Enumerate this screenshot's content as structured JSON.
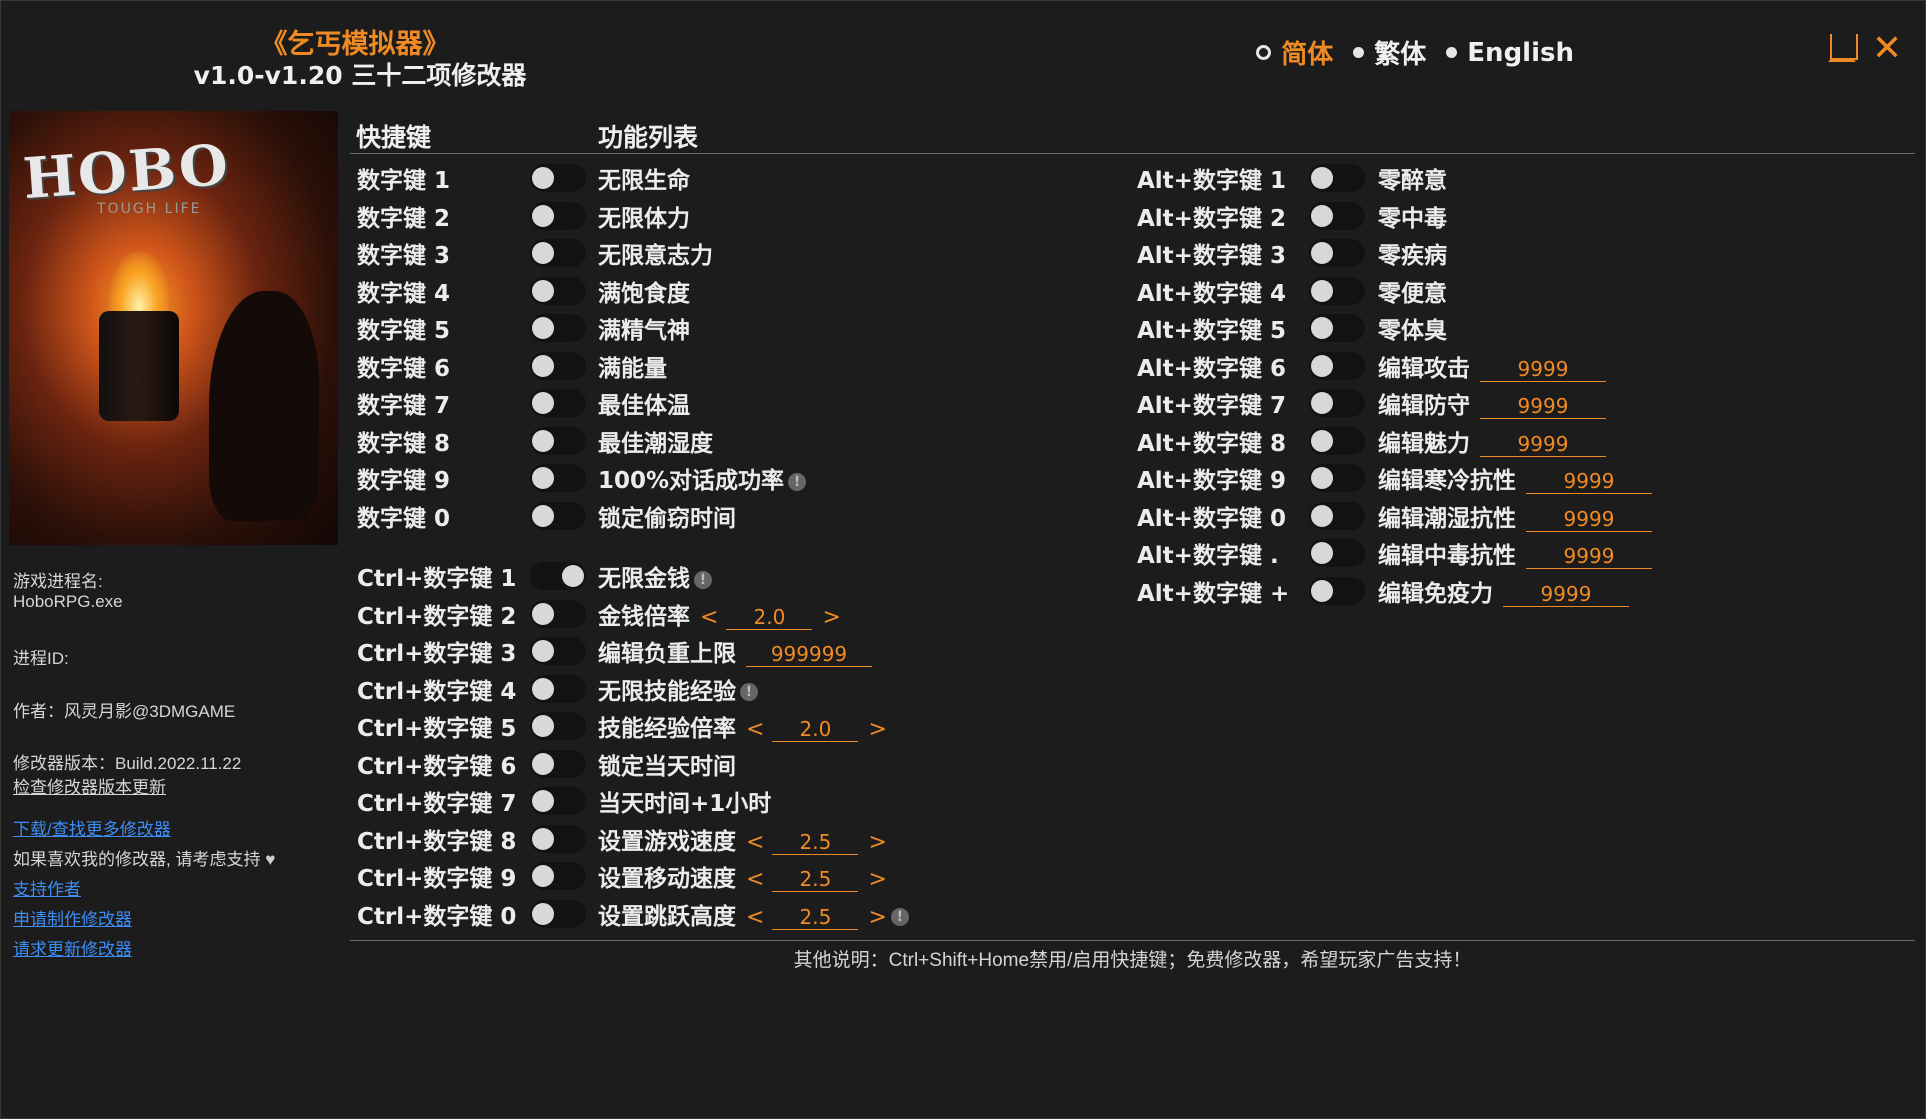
{
  "header": {
    "game_title": "《乞丐模拟器》",
    "version_title": "v1.0-v1.20 三十二项修改器"
  },
  "languages": [
    {
      "label": "简体",
      "active": true
    },
    {
      "label": "繁体",
      "active": false
    },
    {
      "label": "English",
      "active": false
    }
  ],
  "window_controls": {
    "minimize": "minimize-icon",
    "close": "close-icon",
    "close_glyph": "✕"
  },
  "cover": {
    "logo": "HOBO",
    "subtitle": "TOUGH LIFE"
  },
  "sidebar": {
    "process_label": "游戏进程名:",
    "process_name": "HoboRPG.exe",
    "pid_label": "进程ID:",
    "author": "作者：风灵月影@3DMGAME",
    "build": "修改器版本：Build.2022.11.22",
    "check_update": "检查修改器版本更新",
    "download_more": "下载/查找更多修改器",
    "support_text": "如果喜欢我的修改器, 请考虑支持",
    "support_author": "支持作者",
    "request_make": "申请制作修改器",
    "request_update": "请求更新修改器"
  },
  "columns": {
    "hotkey": "快捷键",
    "features": "功能列表"
  },
  "left_group1": [
    {
      "key": "数字键 1",
      "label": "无限生命",
      "on": false
    },
    {
      "key": "数字键 2",
      "label": "无限体力",
      "on": false
    },
    {
      "key": "数字键 3",
      "label": "无限意志力",
      "on": false
    },
    {
      "key": "数字键 4",
      "label": "满饱食度",
      "on": false
    },
    {
      "key": "数字键 5",
      "label": "满精气神",
      "on": false
    },
    {
      "key": "数字键 6",
      "label": "满能量",
      "on": false
    },
    {
      "key": "数字键 7",
      "label": "最佳体温",
      "on": false
    },
    {
      "key": "数字键 8",
      "label": "最佳潮湿度",
      "on": false
    },
    {
      "key": "数字键 9",
      "label": "100%对话成功率",
      "on": false,
      "info": true
    },
    {
      "key": "数字键 0",
      "label": "锁定偷窃时间",
      "on": false
    }
  ],
  "left_group2": [
    {
      "key": "Ctrl+数字键 1",
      "label": "无限金钱",
      "on": true,
      "info": true
    },
    {
      "key": "Ctrl+数字键 2",
      "label": "金钱倍率",
      "on": false,
      "stepper": "2.0"
    },
    {
      "key": "Ctrl+数字键 3",
      "label": "编辑负重上限",
      "on": false,
      "value": "999999"
    },
    {
      "key": "Ctrl+数字键 4",
      "label": "无限技能经验",
      "on": false,
      "info": true
    },
    {
      "key": "Ctrl+数字键 5",
      "label": "技能经验倍率",
      "on": false,
      "stepper": "2.0"
    },
    {
      "key": "Ctrl+数字键 6",
      "label": "锁定当天时间",
      "on": false
    },
    {
      "key": "Ctrl+数字键 7",
      "label": "当天时间+1小时",
      "on": false
    },
    {
      "key": "Ctrl+数字键 8",
      "label": "设置游戏速度",
      "on": false,
      "stepper": "2.5"
    },
    {
      "key": "Ctrl+数字键 9",
      "label": "设置移动速度",
      "on": false,
      "stepper": "2.5"
    },
    {
      "key": "Ctrl+数字键 0",
      "label": "设置跳跃高度",
      "on": false,
      "stepper": "2.5",
      "info": true
    }
  ],
  "right_group": [
    {
      "key": "Alt+数字键 1",
      "label": "零醉意",
      "on": false
    },
    {
      "key": "Alt+数字键 2",
      "label": "零中毒",
      "on": false
    },
    {
      "key": "Alt+数字键 3",
      "label": "零疾病",
      "on": false
    },
    {
      "key": "Alt+数字键 4",
      "label": "零便意",
      "on": false
    },
    {
      "key": "Alt+数字键 5",
      "label": "零体臭",
      "on": false
    },
    {
      "key": "Alt+数字键 6",
      "label": "编辑攻击",
      "on": false,
      "value": "9999"
    },
    {
      "key": "Alt+数字键 7",
      "label": "编辑防守",
      "on": false,
      "value": "9999"
    },
    {
      "key": "Alt+数字键 8",
      "label": "编辑魅力",
      "on": false,
      "value": "9999"
    },
    {
      "key": "Alt+数字键 9",
      "label": "编辑寒冷抗性",
      "on": false,
      "value": "9999"
    },
    {
      "key": "Alt+数字键 0",
      "label": "编辑潮湿抗性",
      "on": false,
      "value": "9999"
    },
    {
      "key": "Alt+数字键 .",
      "label": "编辑中毒抗性",
      "on": false,
      "value": "9999"
    },
    {
      "key": "Alt+数字键 +",
      "label": "编辑免疫力",
      "on": false,
      "value": "9999"
    }
  ],
  "icons": {
    "info": "info-icon",
    "heart": "heart-icon"
  },
  "arrows": {
    "left": "<",
    "right": ">"
  },
  "info_glyph": "!",
  "heart_glyph": "♥",
  "footer": "其他说明：Ctrl+Shift+Home禁用/启用快捷键；免费修改器，希望玩家广告支持！",
  "colors": {
    "accent": "#f08a24",
    "background": "#1c1c1c",
    "link": "#3d8df5"
  }
}
